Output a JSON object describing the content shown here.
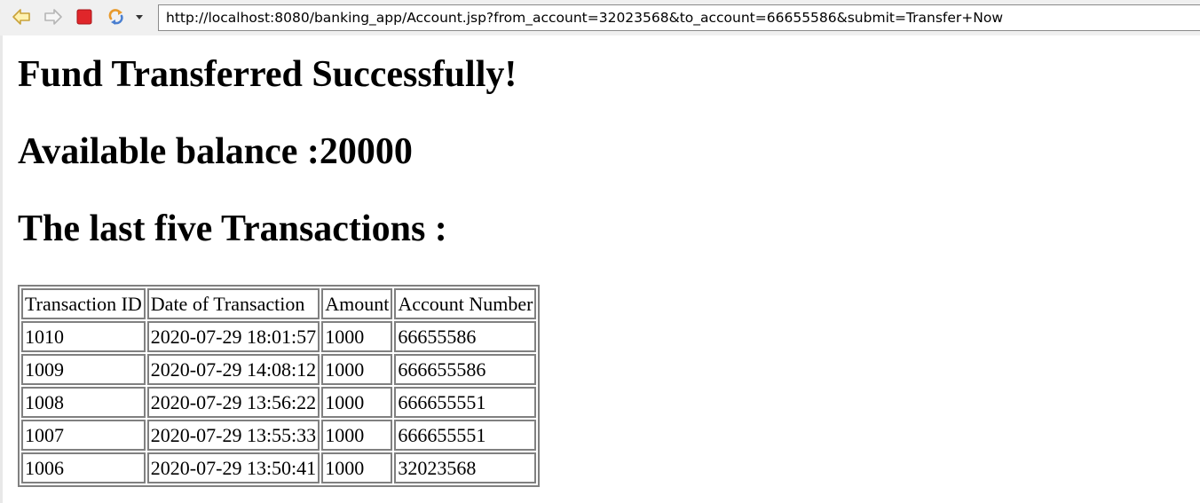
{
  "toolbar": {
    "back_icon": "back-arrow-icon",
    "forward_icon": "forward-arrow-icon",
    "stop_icon": "stop-icon",
    "refresh_icon": "refresh-icon",
    "dropdown_icon": "chevron-down-icon",
    "url": "http://localhost:8080/banking_app/Account.jsp?from_account=32023568&to_account=66655586&submit=Transfer+Now"
  },
  "page": {
    "success_heading": "Fund Transferred Successfully!",
    "balance_heading": "Available balance :20000",
    "transactions_heading": "The last five Transactions :"
  },
  "table": {
    "headers": [
      "Transaction ID",
      "Date of Transaction",
      "Amount",
      "Account Number"
    ],
    "rows": [
      [
        "1010",
        "2020-07-29 18:01:57",
        "1000",
        "66655586"
      ],
      [
        "1009",
        "2020-07-29 14:08:12",
        "1000",
        "666655586"
      ],
      [
        "1008",
        "2020-07-29 13:56:22",
        "1000",
        "666655551"
      ],
      [
        "1007",
        "2020-07-29 13:55:33",
        "1000",
        "666655551"
      ],
      [
        "1006",
        "2020-07-29 13:50:41",
        "1000",
        "32023568"
      ]
    ]
  },
  "colors": {
    "nav_arrow_fill": "#fff2b0",
    "nav_arrow_stroke": "#c9a23a",
    "stop_red": "#e0262a",
    "refresh_orange": "#e89a2c",
    "refresh_blue": "#4a7fd0"
  }
}
